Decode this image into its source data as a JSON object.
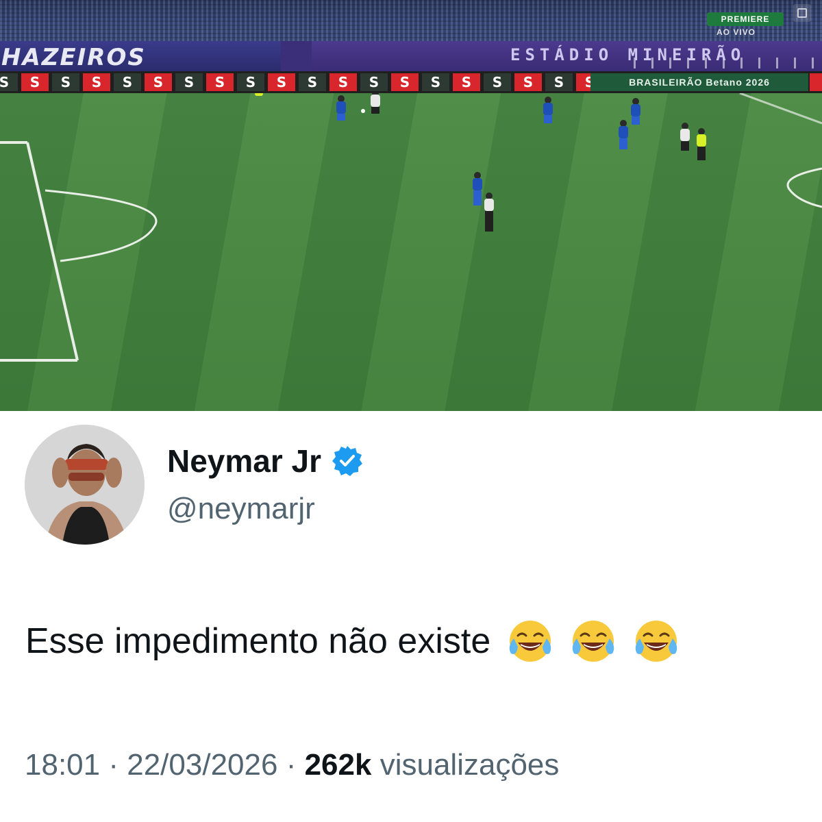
{
  "broadcast": {
    "banner_left": "HAZEIROS",
    "banner_right": "ESTÁDIO MINEIRÃO",
    "ad_letter": "S",
    "sponsor_strip": "BRASILEIRÃO Betano 2026",
    "channel": "PREMIERE",
    "live_label": "AO VIVO"
  },
  "tweet": {
    "display_name": "Neymar Jr",
    "handle": "@neymarjr",
    "text": "Esse impedimento não existe",
    "emoji_count": 3,
    "emoji_icon": "face-with-tears-of-joy-icon",
    "time": "18:01",
    "separator": "·",
    "date": "22/03/2026",
    "views_count": "262k",
    "views_label": "visualizações"
  },
  "colors": {
    "verified_blue": "#1d9bf0",
    "text_primary": "#0f1419",
    "text_secondary": "#536471",
    "pitch_green": "#3f7e3b",
    "ad_red": "#d8262c"
  }
}
